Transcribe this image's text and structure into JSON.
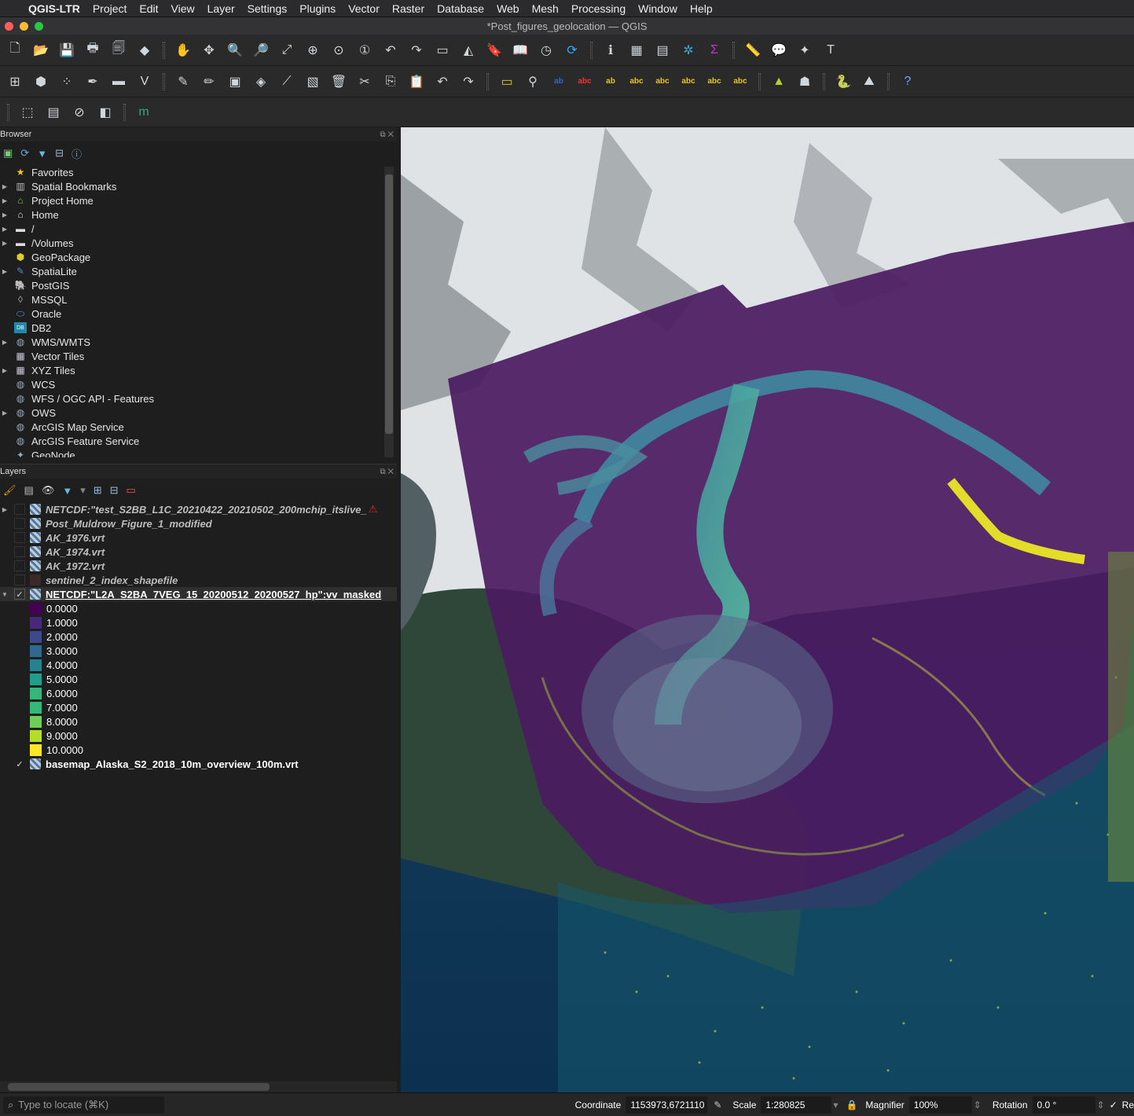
{
  "menubar": {
    "app": "QGIS-LTR",
    "items": [
      "Project",
      "Edit",
      "View",
      "Layer",
      "Settings",
      "Plugins",
      "Vector",
      "Raster",
      "Database",
      "Web",
      "Mesh",
      "Processing",
      "Window",
      "Help"
    ]
  },
  "window": {
    "title": "*Post_figures_geolocation — QGIS"
  },
  "toolbar_icons": {
    "row1": [
      "new-project-icon",
      "open-project-icon",
      "save-project-icon",
      "print-layout-icon",
      "layout-manager-icon",
      "style-manager-icon",
      "pan-icon",
      "pan-to-selection-icon",
      "zoom-in-icon",
      "zoom-out-icon",
      "zoom-full-icon",
      "zoom-selection-icon",
      "zoom-layer-icon",
      "zoom-native-icon",
      "zoom-last-icon",
      "zoom-next-icon",
      "new-map-view-icon",
      "new-3d-view-icon",
      "new-bookmark-icon",
      "show-bookmarks-icon",
      "temporal-controller-icon",
      "refresh-icon",
      "identify-icon",
      "attribute-table-icon",
      "statistics-icon",
      "settings-icon",
      "sum-icon",
      "measure-icon",
      "map-tips-icon",
      "annotation-icon",
      "text-annotation-icon"
    ],
    "row2": [
      "data-source-manager-icon",
      "new-geopackage-icon",
      "new-temp-layer-icon",
      "digitize-icon",
      "save-edits-icon",
      "virtual-layer-icon",
      "edit-pencil-icon",
      "edit-icon",
      "save-layer-icon",
      "add-feature-icon",
      "vertex-tool-icon",
      "modify-attributes-icon",
      "delete-selected-icon",
      "cut-icon",
      "copy-icon",
      "paste-icon",
      "undo-icon",
      "redo-icon",
      "label-toolbar-icon",
      "pin-label-icon",
      "label-abc-icon",
      "label-abc-red-icon",
      "label-move-icon",
      "label-rotate-icon",
      "label-change-icon",
      "label-show-icon",
      "label-pin-icon",
      "label-highlight-icon",
      "georeferencer-icon",
      "grass-icon",
      "python-icon",
      "plugin-icon",
      "help-icon"
    ],
    "row3": [
      "select-feature-icon",
      "select-value-icon",
      "deselect-icon",
      "select-location-icon",
      "mergin-icon"
    ]
  },
  "browser": {
    "title": "Browser",
    "items": [
      {
        "label": "Favorites",
        "icon": "star-icon",
        "expandable": false
      },
      {
        "label": "Spatial Bookmarks",
        "icon": "bookmark-icon",
        "expandable": true
      },
      {
        "label": "Project Home",
        "icon": "project-home-icon",
        "expandable": true
      },
      {
        "label": "Home",
        "icon": "home-icon",
        "expandable": true
      },
      {
        "label": "/",
        "icon": "folder-icon",
        "expandable": true
      },
      {
        "label": "/Volumes",
        "icon": "folder-icon",
        "expandable": true
      },
      {
        "label": "GeoPackage",
        "icon": "geopackage-icon",
        "expandable": false
      },
      {
        "label": "SpatiaLite",
        "icon": "spatialite-icon",
        "expandable": true
      },
      {
        "label": "PostGIS",
        "icon": "postgis-icon",
        "expandable": false
      },
      {
        "label": "MSSQL",
        "icon": "mssql-icon",
        "expandable": false
      },
      {
        "label": "Oracle",
        "icon": "oracle-icon",
        "expandable": false
      },
      {
        "label": "DB2",
        "icon": "db2-icon",
        "expandable": false
      },
      {
        "label": "WMS/WMTS",
        "icon": "globe-icon",
        "expandable": true
      },
      {
        "label": "Vector Tiles",
        "icon": "grid-icon",
        "expandable": false
      },
      {
        "label": "XYZ Tiles",
        "icon": "grid-icon",
        "expandable": true
      },
      {
        "label": "WCS",
        "icon": "globe-icon",
        "expandable": false
      },
      {
        "label": "WFS / OGC API - Features",
        "icon": "globe-icon",
        "expandable": false
      },
      {
        "label": "OWS",
        "icon": "globe-icon",
        "expandable": true
      },
      {
        "label": "ArcGIS Map Service",
        "icon": "globe-icon",
        "expandable": false
      },
      {
        "label": "ArcGIS Feature Service",
        "icon": "globe-icon",
        "expandable": false
      },
      {
        "label": "GeoNode",
        "icon": "geonode-icon",
        "expandable": false
      }
    ]
  },
  "layers": {
    "title": "Layers",
    "items": [
      {
        "label": "NETCDF:\"test_S2BB_L1C_20210422_20210502_200mchip_itslive_",
        "checked": false,
        "italic": true,
        "expandable": true,
        "warning": true
      },
      {
        "label": "Post_Muldrow_Figure_1_modified",
        "checked": false,
        "italic": true,
        "expandable": false
      },
      {
        "label": "AK_1976.vrt",
        "checked": false,
        "italic": true,
        "expandable": false
      },
      {
        "label": "AK_1974.vrt",
        "checked": false,
        "italic": true,
        "expandable": false
      },
      {
        "label": "AK_1972.vrt",
        "checked": false,
        "italic": true,
        "expandable": false
      },
      {
        "label": "sentinel_2_index_shapefile",
        "checked": false,
        "italic": true,
        "expandable": false
      }
    ],
    "active": {
      "label": "NETCDF:\"L2A_S2BA_7VEG_15_20200512_20200527_hp\":vv_masked",
      "checked": "✓"
    },
    "legend": [
      {
        "label": "0.0000",
        "color": "#440154"
      },
      {
        "label": "1.0000",
        "color": "#482878"
      },
      {
        "label": "2.0000",
        "color": "#3e4989"
      },
      {
        "label": "3.0000",
        "color": "#31688e"
      },
      {
        "label": "4.0000",
        "color": "#26828e"
      },
      {
        "label": "5.0000",
        "color": "#1f9e89"
      },
      {
        "label": "6.0000",
        "color": "#35b779"
      },
      {
        "label": "7.0000",
        "color": "#35b779"
      },
      {
        "label": "8.0000",
        "color": "#6ece58"
      },
      {
        "label": "9.0000",
        "color": "#b5de2b"
      },
      {
        "label": "10.0000",
        "color": "#fde725"
      }
    ],
    "basemap": {
      "label": "basemap_Alaska_S2_2018_10m_overview_100m.vrt",
      "checked": "✓"
    }
  },
  "status": {
    "locate_placeholder": "Type to locate (⌘K)",
    "coordinate_label": "Coordinate",
    "coordinate_value": "1153973,6721110",
    "scale_label": "Scale",
    "scale_value": "1:280825",
    "magnifier_label": "Magnifier",
    "magnifier_value": "100%",
    "rotation_label": "Rotation",
    "rotation_value": "0.0 °",
    "render_label": "Re"
  }
}
